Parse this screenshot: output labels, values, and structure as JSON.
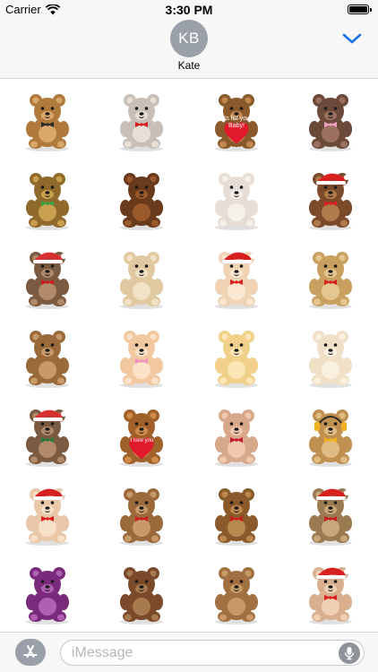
{
  "status_bar": {
    "carrier": "Carrier",
    "time": "3:30 PM"
  },
  "header": {
    "avatar_initials": "KB",
    "contact_name": "Kate"
  },
  "stickers": [
    {
      "name": "bear-vest"
    },
    {
      "name": "bear-red-bow-grey"
    },
    {
      "name": "bear-heart-card"
    },
    {
      "name": "bear-pink-belly"
    },
    {
      "name": "bear-face-green"
    },
    {
      "name": "bear-fuzzy-brown"
    },
    {
      "name": "bear-bonnet-vintage"
    },
    {
      "name": "bear-santa-hat"
    },
    {
      "name": "bear-striped-beanie"
    },
    {
      "name": "bear-hug-pair-beige"
    },
    {
      "name": "bear-santa-flower"
    },
    {
      "name": "bear-tan-bow"
    },
    {
      "name": "bear-family-three"
    },
    {
      "name": "bear-hug-hearts"
    },
    {
      "name": "bear-arms-up"
    },
    {
      "name": "bear-cream-orange"
    },
    {
      "name": "bear-striped-sweater"
    },
    {
      "name": "bear-love-you"
    },
    {
      "name": "bear-heart-pillow"
    },
    {
      "name": "bear-headphones"
    },
    {
      "name": "bear-santa-baby"
    },
    {
      "name": "bear-red-scarf"
    },
    {
      "name": "bear-ribbon"
    },
    {
      "name": "bear-christmas-scarf"
    },
    {
      "name": "bear-purple"
    },
    {
      "name": "bear-waving"
    },
    {
      "name": "bear-standing-brown"
    },
    {
      "name": "bear-santa-card"
    }
  ],
  "sticker_texts": {
    "heart_card": "It's for you, Baby!",
    "love_you": "I love you"
  },
  "input_bar": {
    "placeholder": "iMessage"
  },
  "colors": {
    "accent": "#1a73e8",
    "avatar_bg": "#9aa0a8",
    "bar_bg": "#f7f7f7"
  }
}
